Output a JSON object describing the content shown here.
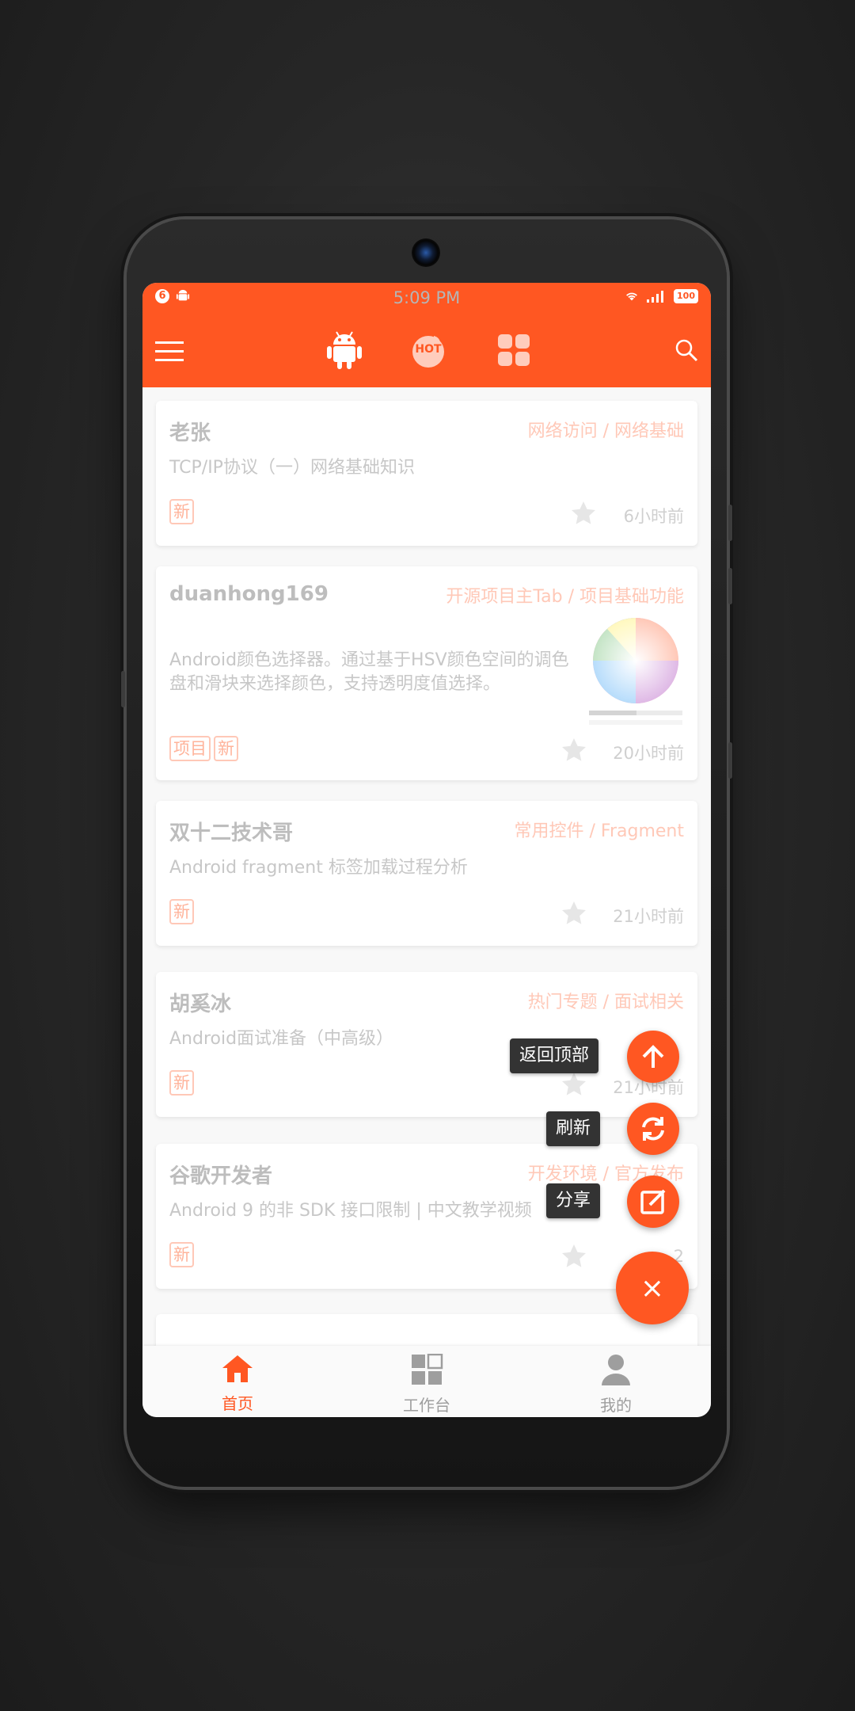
{
  "status_bar": {
    "time": "5:09 PM",
    "notif_count": "6",
    "battery": "100"
  },
  "toolbar": {
    "menu_icon": "menu-icon",
    "tabs": [
      "android-icon",
      "hot-icon",
      "grid-icon"
    ],
    "search_icon": "search-icon",
    "hot_label": "HOT"
  },
  "articles": [
    {
      "author": "老张",
      "category": "网络访问 / 网络基础",
      "title": "TCP/IP协议（一）网络基础知识",
      "tags": [
        "新"
      ],
      "time": "6小时前"
    },
    {
      "author": "duanhong169",
      "category": "开源项目主Tab / 项目基础功能",
      "title": "Android颜色选择器。通过基于HSV颜色空间的调色盘和滑块来选择颜色，支持透明度值选择。",
      "tags": [
        "项目",
        "新"
      ],
      "time": "20小时前"
    },
    {
      "author": "双十二技术哥",
      "category": "常用控件 / Fragment",
      "title": "Android fragment 标签加载过程分析",
      "tags": [
        "新"
      ],
      "time": "21小时前"
    },
    {
      "author": "胡奚冰",
      "category": "热门专题 / 面试相关",
      "title": "Android面试准备（中高级）",
      "tags": [
        "新"
      ],
      "time": "21小时前"
    },
    {
      "author": "谷歌开发者",
      "category": "开发环境 / 官方发布",
      "title": "Android 9 的非 SDK 接口限制 | 中文教学视频",
      "tags": [
        "新"
      ],
      "time": "2"
    }
  ],
  "fab": {
    "main_label": "×",
    "actions": [
      {
        "label": "返回顶部",
        "icon": "arrow-up-icon"
      },
      {
        "label": "刷新",
        "icon": "refresh-icon"
      },
      {
        "label": "分享",
        "icon": "edit-share-icon"
      }
    ]
  },
  "bottom_nav": [
    {
      "label": "首页",
      "icon": "home-icon",
      "active": true
    },
    {
      "label": "工作台",
      "icon": "dashboard-icon",
      "active": false
    },
    {
      "label": "我的",
      "icon": "person-icon",
      "active": false
    }
  ],
  "colors": {
    "accent": "#ff5722",
    "tag": "#ffab91",
    "nav_inactive": "#9e9e9e"
  }
}
